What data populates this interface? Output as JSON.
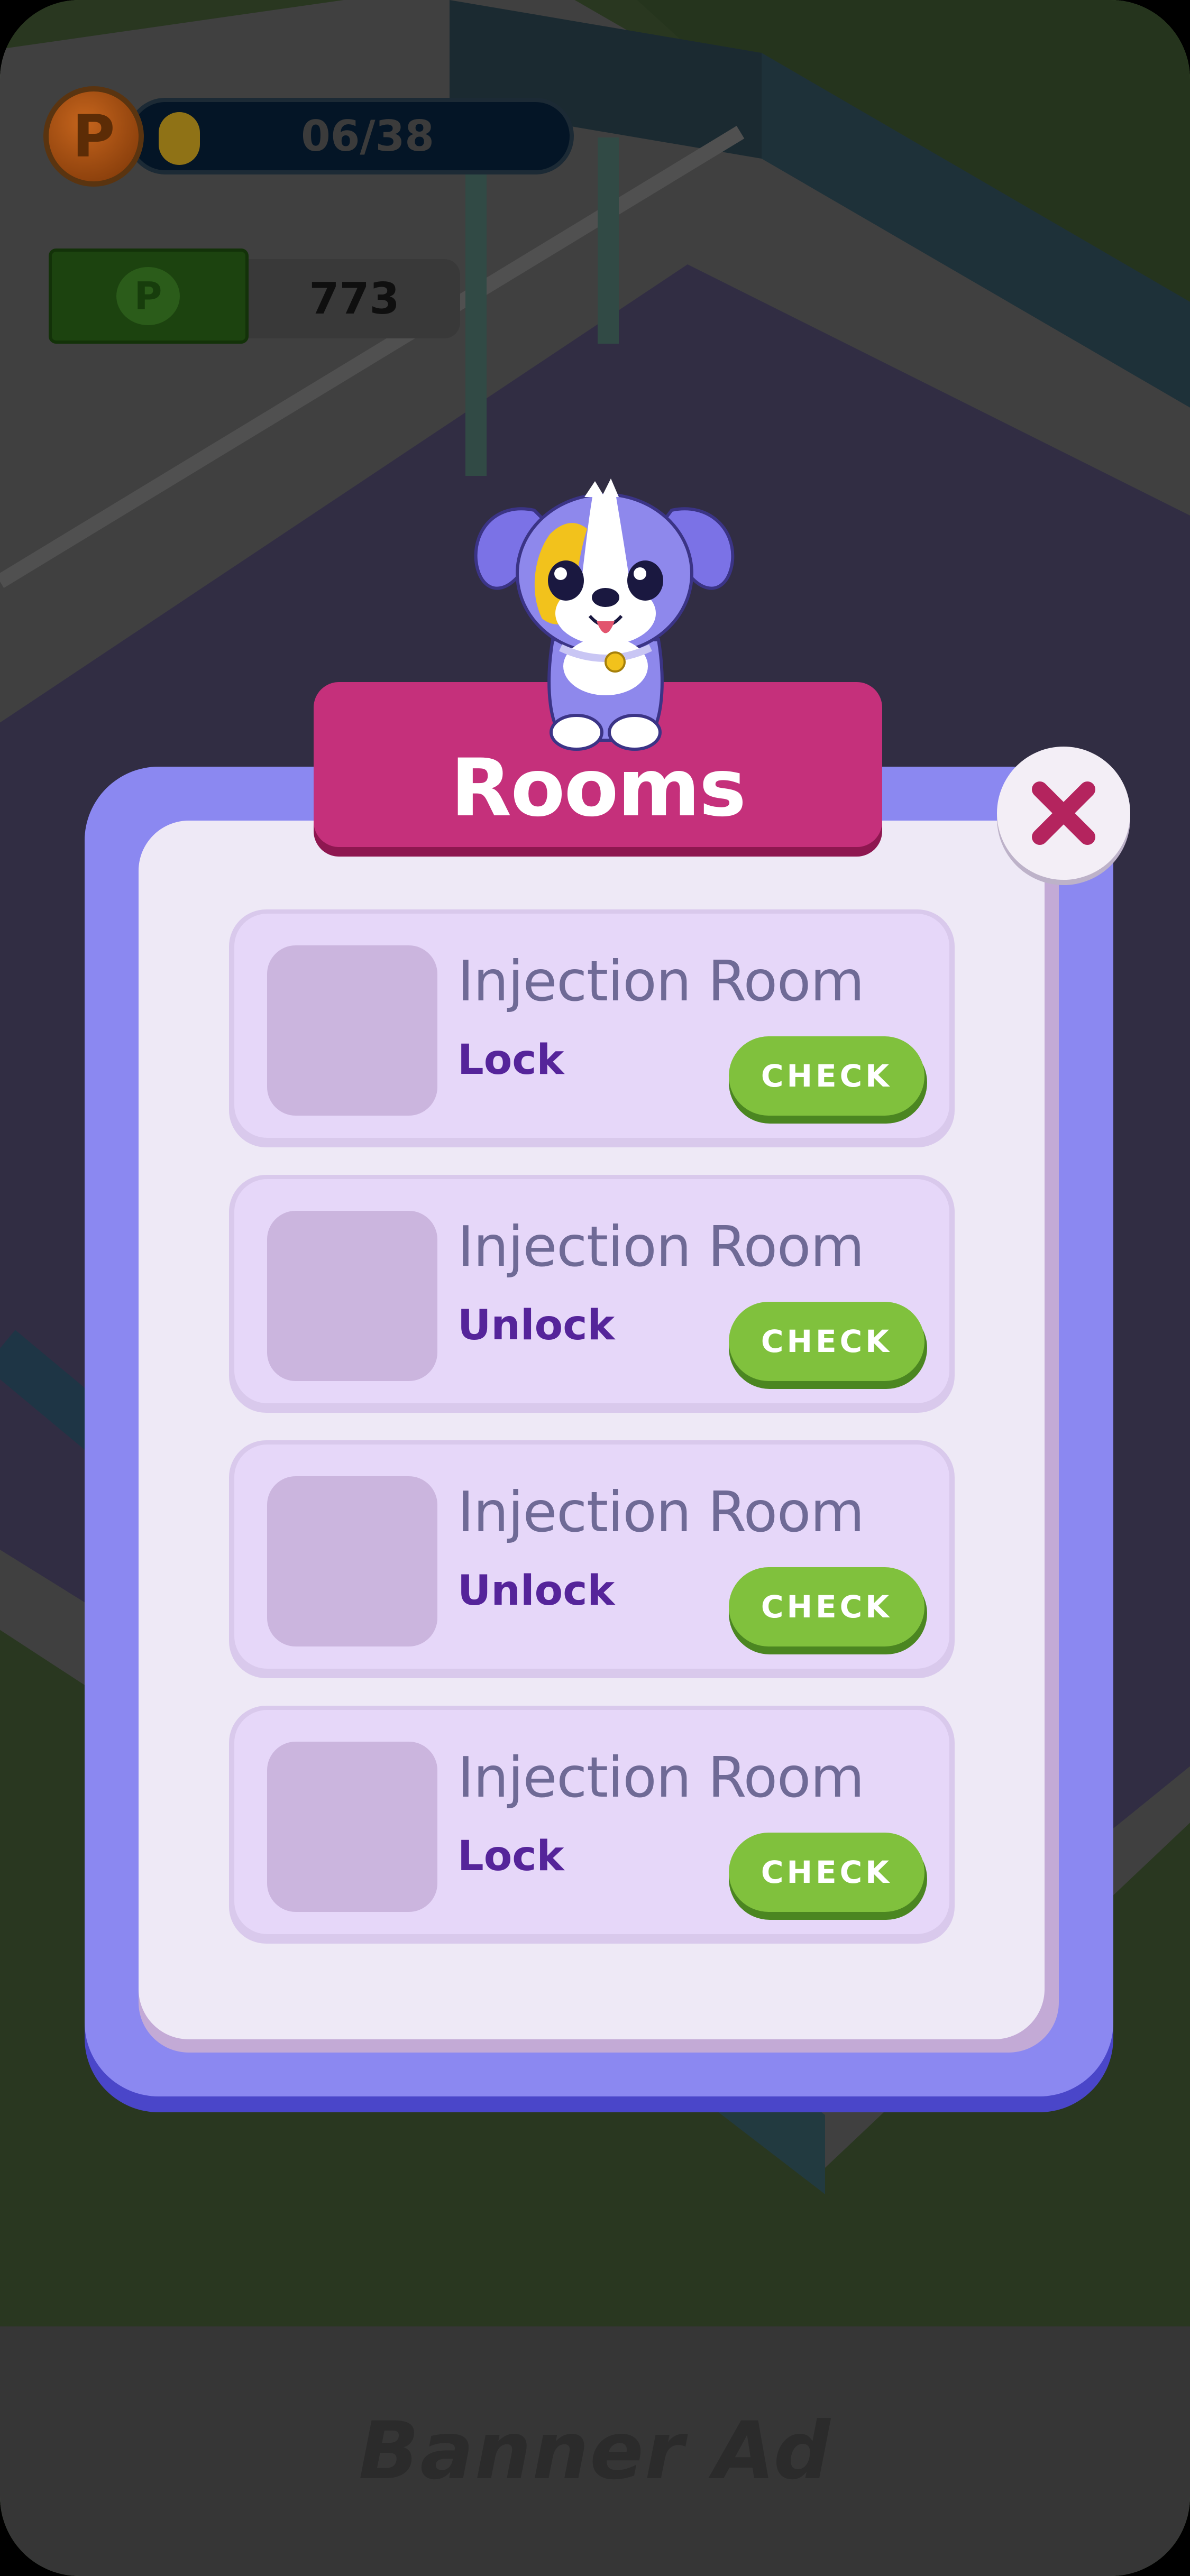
{
  "hud": {
    "coin_symbol": "P",
    "progress_text": "06/38",
    "cash_symbol": "P",
    "cash_amount": "773"
  },
  "dialog": {
    "title": "Rooms",
    "close_icon": "close-x-icon",
    "mascot_icon": "puppy-mascot"
  },
  "rooms": [
    {
      "name": "Injection Room",
      "status": "Lock",
      "button": "CHECK"
    },
    {
      "name": "Injection Room",
      "status": "Unlock",
      "button": "CHECK"
    },
    {
      "name": "Injection Room",
      "status": "Unlock",
      "button": "CHECK"
    },
    {
      "name": "Injection Room",
      "status": "Lock",
      "button": "CHECK"
    }
  ],
  "banner": {
    "text": "Banner Ad"
  },
  "colors": {
    "title_plate": "#c5307b",
    "dialog_rim": "#8b88f1",
    "card": "#e6d7f9",
    "check_button": "#80c13d",
    "status_text": "#55249a"
  }
}
